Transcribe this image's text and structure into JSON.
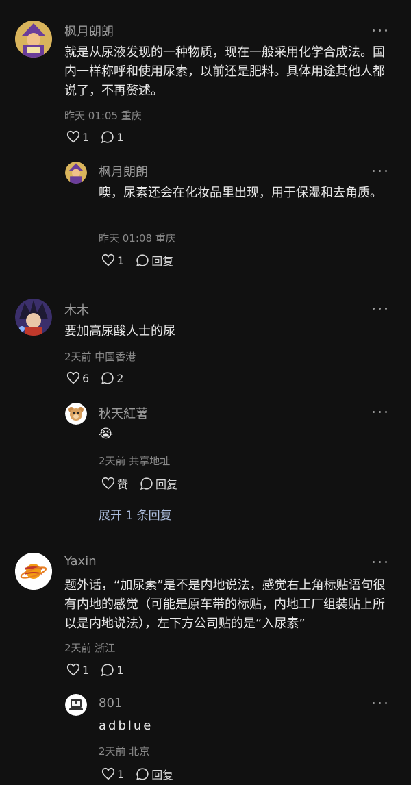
{
  "comments": [
    {
      "author": "枫月朗朗",
      "text": "就是从尿液发现的一种物质，现在一般采用化学合成法。国内一样称呼和使用尿素，以前还是肥料。具体用途其他人都说了，不再赘述。",
      "meta": "昨天 01:05 重庆",
      "likes": "1",
      "replies": "1",
      "avatar_icon": "wizard-avatar",
      "reply": {
        "author": "枫月朗朗",
        "text": "噢，尿素还会在化妆品里出现，用于保湿和去角质。",
        "meta": "昨天 01:08 重庆",
        "likes": "1",
        "reply_label": "回复",
        "avatar_icon": "wizard-avatar"
      }
    },
    {
      "author": "木木",
      "text": "要加高尿酸人士的尿",
      "meta": "2天前 中国香港",
      "likes": "6",
      "replies": "2",
      "avatar_icon": "anime-avatar",
      "reply": {
        "author": "秋天紅薯",
        "text": "😭",
        "meta": "2天前 共享地址",
        "likes": "赞",
        "reply_label": "回复",
        "avatar_icon": "bear-avatar"
      },
      "expand_label": "展开 1 条回复"
    },
    {
      "author": "Yaxin",
      "text": "题外话，“加尿素”是不是内地说法，感觉右上角标贴语句很有内地的感觉（可能是原车带的标贴，内地工厂组装贴上所以是内地说法），左下方公司贴的是“入尿素”",
      "meta": "2天前 浙江",
      "likes": "1",
      "replies": "1",
      "avatar_icon": "planet-avatar",
      "reply": {
        "author": "801",
        "text": "adblue",
        "meta": "2天前 北京",
        "likes": "1",
        "reply_label": "回复",
        "avatar_icon": "computer-avatar"
      }
    }
  ]
}
